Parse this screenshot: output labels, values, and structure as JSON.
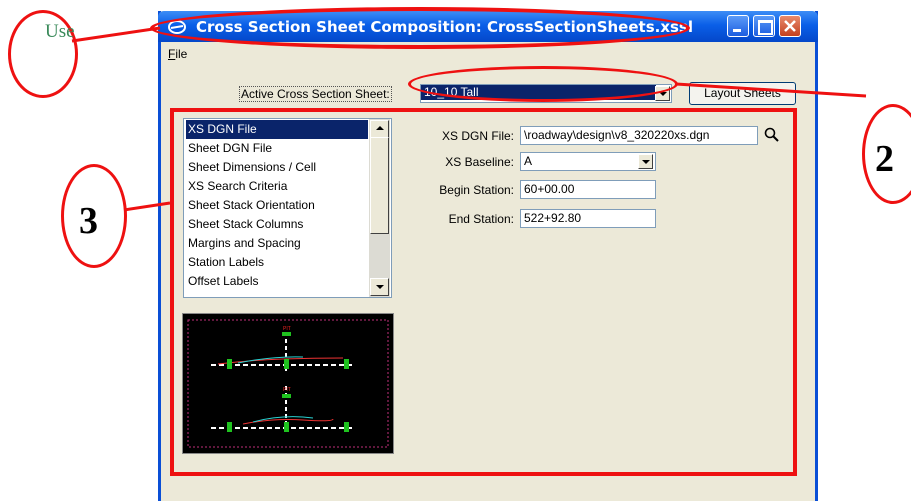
{
  "annotation": {
    "use_text": "Use",
    "numbers": [
      "2",
      "3"
    ]
  },
  "window": {
    "title": "Cross Section Sheet Composition: CrossSectionSheets.xssl",
    "menu": [
      "File"
    ]
  },
  "top_row": {
    "active_label": "Active Cross Section Sheet:",
    "active_value": "10_10 Tall",
    "layout_button": "Layout Sheets"
  },
  "list": {
    "items": [
      "XS DGN File",
      "Sheet DGN File",
      "Sheet Dimensions / Cell",
      "XS Search Criteria",
      "Sheet Stack Orientation",
      "Sheet Stack Columns",
      "Margins and Spacing",
      "Station Labels",
      "Offset Labels"
    ],
    "selected": "XS DGN File"
  },
  "fields": {
    "xs_dgn_label": "XS DGN File:",
    "xs_dgn_value": "\\roadway\\design\\v8_320220xs.dgn",
    "baseline_label": "XS Baseline:",
    "baseline_value": "A",
    "begin_label": "Begin Station:",
    "begin_value": "60+00.00",
    "end_label": "End Station:",
    "end_value": "522+92.80"
  },
  "colors": {
    "annotation_red": "#e11111",
    "title_blue": "#0a5fe8",
    "selection": "#0a246a"
  }
}
